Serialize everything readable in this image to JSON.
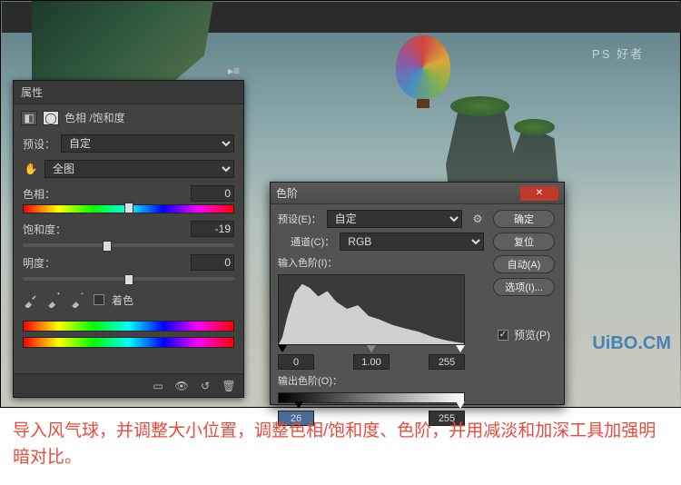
{
  "watermarks": {
    "top": "PS 好者",
    "bottom": "UiBO.CM"
  },
  "properties_panel": {
    "title": "属性",
    "adjustment_name": "色相 /饱和度",
    "preset_label": "预设：",
    "preset_value": "自定",
    "range_label": "全图",
    "hue": {
      "label": "色相：",
      "value": "0",
      "thumb_pct": 50
    },
    "saturation": {
      "label": "饱和度：",
      "value": "-19",
      "thumb_pct": 40
    },
    "lightness": {
      "label": "明度：",
      "value": "0",
      "thumb_pct": 50
    },
    "colorize_label": "着色",
    "footer_icons": [
      "clip-icon",
      "eye-icon",
      "reset-icon",
      "delete-icon"
    ]
  },
  "levels_dialog": {
    "title": "色阶",
    "preset_label": "预设(E)：",
    "preset_value": "自定",
    "channel_label": "通道(C)：",
    "channel_value": "RGB",
    "input_label": "输入色阶(I)：",
    "input_values": {
      "black": "0",
      "gamma": "1.00",
      "white": "255"
    },
    "output_label": "输出色阶(O)：",
    "output_values": {
      "black": "26",
      "white": "255"
    },
    "buttons": {
      "ok": "确定",
      "reset": "复位",
      "auto": "自动(A)",
      "options": "选项(I)..."
    },
    "preview_label": "预览(P)",
    "preview_checked": true
  },
  "caption": "导入风气球，并调整大小位置，调整色相/饱和度、色阶，并用减淡和加深工具加强明暗对比。"
}
